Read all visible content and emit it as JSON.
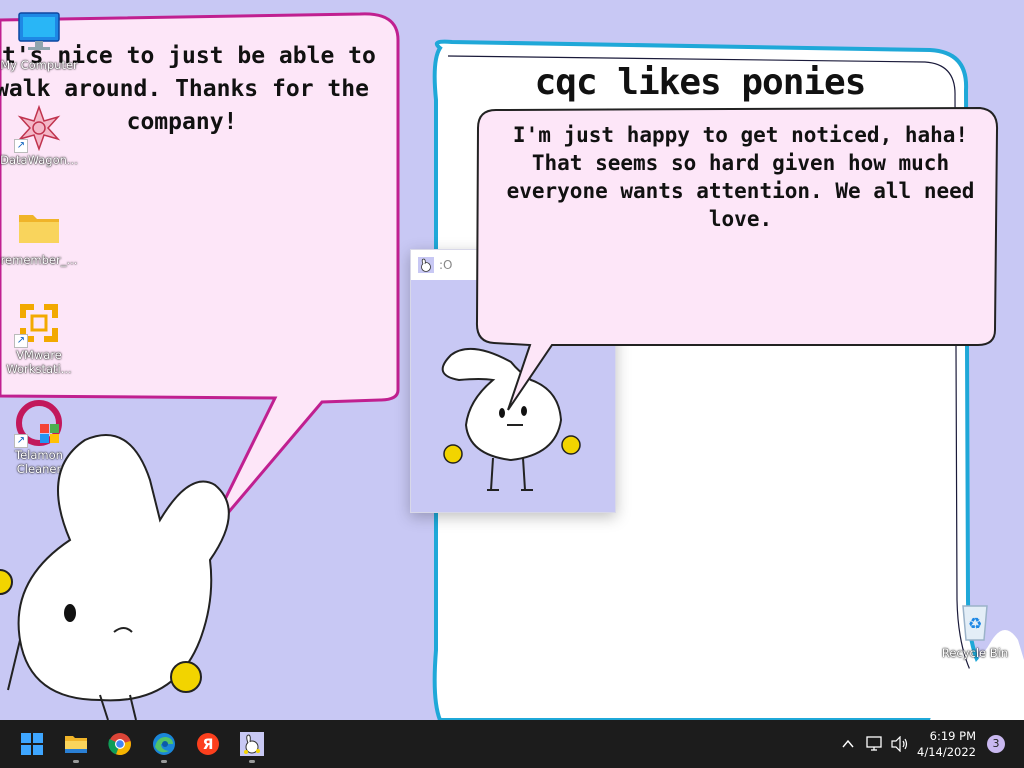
{
  "wallpaper": {
    "left_bubble_text": "It's nice to just be able to walk around. Thanks for the company!",
    "board_title": "cqc likes ponies",
    "middle_bubble_text": "I'm just happy to get noticed, haha! That seems so hard given how much everyone wants attention. We all need love."
  },
  "desktop_icons": [
    {
      "label": "My Computer",
      "icon": "monitor-icon"
    },
    {
      "label": "DataWagon...",
      "icon": "datawagon-icon"
    },
    {
      "label": "remember_...",
      "icon": "folder-icon"
    },
    {
      "label": "VMware Workstati...",
      "icon": "vmware-icon"
    },
    {
      "label": "Telamon Cleaner",
      "icon": "telamon-cleaner-icon"
    },
    {
      "label": "Recycle Bin",
      "icon": "recycle-bin-icon"
    }
  ],
  "mini_window": {
    "title": ":O",
    "icon": "bunny-app-icon"
  },
  "taskbar": {
    "apps": [
      {
        "name": "Start",
        "icon": "windows-start-icon"
      },
      {
        "name": "File Explorer",
        "icon": "file-explorer-icon",
        "running": true
      },
      {
        "name": "Google Chrome",
        "icon": "chrome-icon"
      },
      {
        "name": "Microsoft Edge",
        "icon": "edge-icon",
        "running": true
      },
      {
        "name": "Yandex Browser",
        "icon": "yandex-icon"
      },
      {
        "name": "Bunny pet app",
        "icon": "bunny-app-icon",
        "running": true
      }
    ],
    "tray": {
      "icons": [
        "chevron-up-icon",
        "network-icon",
        "volume-icon"
      ],
      "time": "6:19 PM",
      "date": "4/14/2022",
      "notification_count": "3"
    }
  },
  "colors": {
    "wallpaper": "#c8c8f4",
    "bubble_pink": "#fde6f8",
    "bubble_outline": "#c02090",
    "board_outline": "#1fa8d8",
    "taskbar": "#1c1c1c",
    "creature_accent": "#f2d400"
  }
}
